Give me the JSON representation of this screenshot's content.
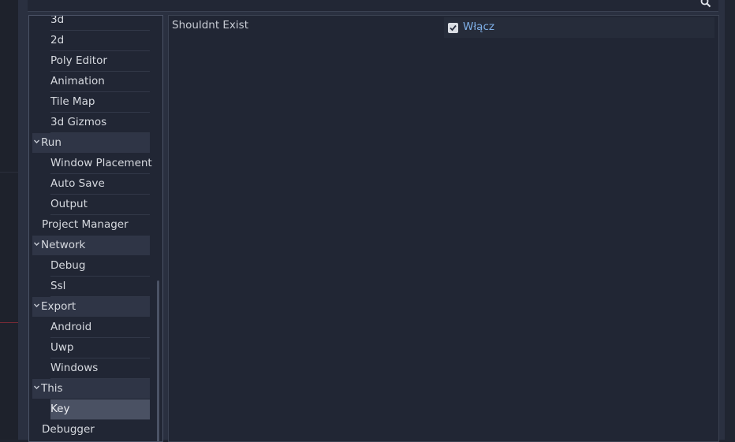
{
  "tree": {
    "items": [
      {
        "label": "3d",
        "kind": "child"
      },
      {
        "label": "2d",
        "kind": "child"
      },
      {
        "label": "Poly Editor",
        "kind": "child"
      },
      {
        "label": "Animation",
        "kind": "child"
      },
      {
        "label": "Tile Map",
        "kind": "child"
      },
      {
        "label": "3d Gizmos",
        "kind": "child"
      },
      {
        "label": "Run",
        "kind": "section"
      },
      {
        "label": "Window Placement",
        "kind": "child"
      },
      {
        "label": "Auto Save",
        "kind": "child"
      },
      {
        "label": "Output",
        "kind": "child"
      },
      {
        "label": "Project Manager",
        "kind": "plain"
      },
      {
        "label": "Network",
        "kind": "section"
      },
      {
        "label": "Debug",
        "kind": "child"
      },
      {
        "label": "Ssl",
        "kind": "child"
      },
      {
        "label": "Export",
        "kind": "section"
      },
      {
        "label": "Android",
        "kind": "child"
      },
      {
        "label": "Uwp",
        "kind": "child"
      },
      {
        "label": "Windows",
        "kind": "child"
      },
      {
        "label": "This",
        "kind": "section"
      },
      {
        "label": "Key",
        "kind": "child",
        "selected": true
      },
      {
        "label": "Debugger",
        "kind": "plain"
      }
    ]
  },
  "inspector": {
    "property_name": "Shouldnt Exist",
    "checkbox_label": "Włącz",
    "checked": true
  },
  "colors": {
    "accent": "#7fb0e8",
    "background": "#212634"
  },
  "icons": {
    "search": "search-icon",
    "expand": "chevron-down-icon",
    "check": "checkmark-icon"
  }
}
